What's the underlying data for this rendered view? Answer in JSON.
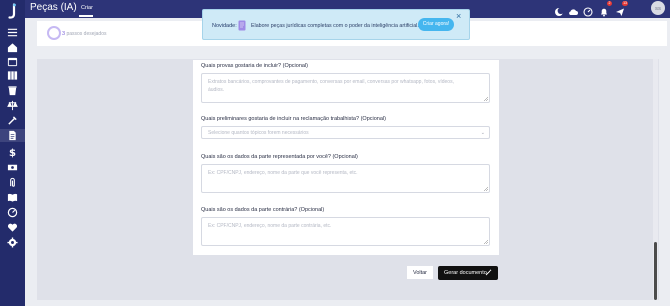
{
  "colors": {
    "sidebar": "#232b6b",
    "topbar": "#2d3478",
    "accent_purple": "#7a63d7",
    "notice_bg": "#cfeaf7",
    "notice_button": "#45b6ef",
    "generate_button": "#111111"
  },
  "topbar": {
    "title": "Peças (IA)",
    "tab": "Criar",
    "avatar_initials": "SS",
    "icons": [
      "moon-icon",
      "cloud-icon",
      "speed-icon",
      "bell-icon",
      "plane-icon"
    ],
    "bell_badge": "2",
    "plane_badge": "13"
  },
  "sidebar": {
    "icons": [
      "menu-icon",
      "home-icon",
      "calendar-icon",
      "columns-icon",
      "trash-icon",
      "scale-icon",
      "tools-icon",
      "document-icon",
      "dollar-icon",
      "money-icon",
      "clip-icon",
      "book-icon",
      "gauge-icon",
      "heart-icon",
      "settings-icon"
    ],
    "active_index": 7
  },
  "steps": {
    "current": "3",
    "label": "passos desejados"
  },
  "notice": {
    "label": "Novidade:",
    "text": "Elabore peças jurídicas completas com o poder da inteligência artificial.",
    "button": "Criar agora!",
    "close": "×"
  },
  "form": {
    "questions": [
      {
        "label": "Quais provas gostaria de incluir? (Opcional)",
        "placeholder": "Extratos bancários, comprovantes de pagamento, conversas por email, conversas por whatsapp, fotos, vídeos, áudios."
      },
      {
        "label": "Quais preliminares gostaria de incluir na reclamação trabalhista? (Opcional)",
        "placeholder": "Selecione quantos tópicos forem necessários"
      },
      {
        "label": "Quais são os dados da parte representada por você? (Opcional)",
        "placeholder": "Ex: CPF/CNPJ, endereço, nome da parte que você representa, etc."
      },
      {
        "label": "Quais são os dados da parte contrária? (Opcional)",
        "placeholder": "Ex: CPF/CNPJ, endereço, nome da parte contrária, etc."
      }
    ]
  },
  "actions": {
    "back": "Voltar",
    "generate": "Gerar documento"
  }
}
